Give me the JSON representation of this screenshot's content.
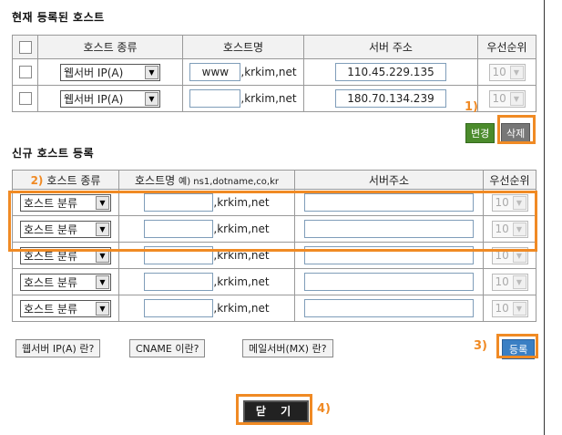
{
  "current": {
    "title": "현재 등록된 호스트",
    "headers": [
      "호스트 종류",
      "호스트명",
      "서버 주소",
      "우선순위"
    ],
    "rows": [
      {
        "type": "웹서버 IP(A)",
        "host": "www",
        "suffix": ",krkim,net",
        "ip": "110.45.229.135",
        "priority": "10"
      },
      {
        "type": "웹서버 IP(A)",
        "host": "",
        "suffix": ",krkim,net",
        "ip": "180.70.134.239",
        "priority": "10"
      }
    ],
    "edit_label": "변경",
    "delete_label": "삭제"
  },
  "new": {
    "title": "신규 호스트 등록",
    "headers": {
      "type": "호스트 종류",
      "host": "호스트명",
      "host_example": "예) ns1,dotname,co,kr",
      "server": "서버주소",
      "priority": "우선순위"
    },
    "rows": [
      {
        "type": "호스트 분류",
        "suffix": ",krkim,net",
        "priority": "10"
      },
      {
        "type": "호스트 분류",
        "suffix": ",krkim,net",
        "priority": "10"
      },
      {
        "type": "호스트 분류",
        "suffix": ",krkim,net",
        "priority": "10"
      },
      {
        "type": "호스트 분류",
        "suffix": ",krkim,net",
        "priority": "10"
      },
      {
        "type": "호스트 분류",
        "suffix": ",krkim,net",
        "priority": "10"
      }
    ],
    "help_buttons": [
      "웹서버 IP(A) 란?",
      "CNAME 이란?",
      "메일서버(MX) 란?"
    ],
    "register_label": "등록"
  },
  "close_label": "닫 기",
  "annotations": [
    "1)",
    "2)",
    "3)",
    "4)"
  ],
  "colors": {
    "annotation": "#f08a24",
    "edit": "#4b8b2c",
    "register": "#3a7fc4"
  }
}
